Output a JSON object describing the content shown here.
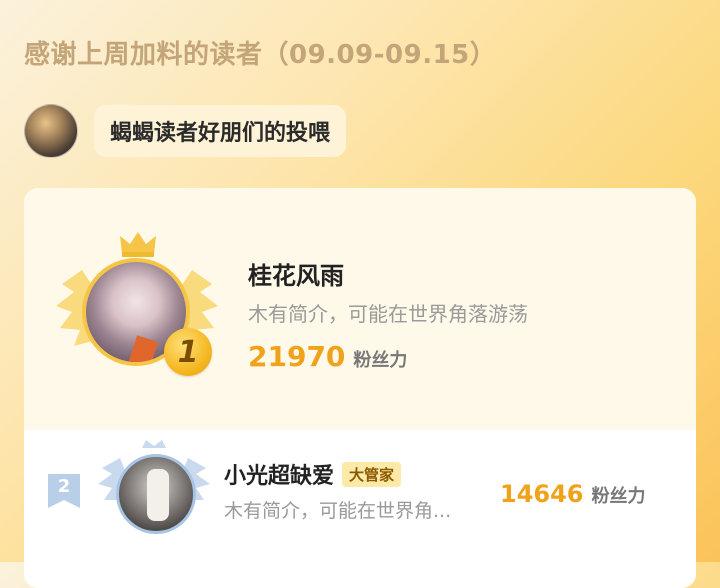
{
  "header": {
    "title": "感谢上周加料的读者（09.09-09.15）"
  },
  "author": {
    "message": "蝎蝎读者好朋们的投喂"
  },
  "ranking": [
    {
      "rank": "1",
      "name": "桂花风雨",
      "bio": "木有简介，可能在世界角落游荡",
      "fans_count": "21970",
      "fans_label": "粉丝力"
    },
    {
      "rank": "2",
      "name": "小光超缺爱",
      "badge": "大管家",
      "bio": "木有简介，可能在世界角...",
      "fans_count": "14646",
      "fans_label": "粉丝力"
    }
  ],
  "colors": {
    "accent_gold": "#f0a21a",
    "crown_gold": "#f6c548",
    "silver_blue": "#a8c4e4"
  },
  "icons": [
    "crown-icon",
    "wings-icon",
    "gold-medal-icon",
    "rank-ribbon-icon"
  ]
}
